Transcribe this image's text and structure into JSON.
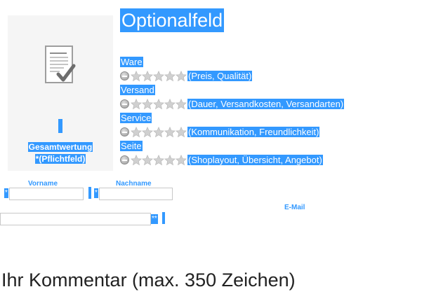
{
  "summary": {
    "icon": "document-check-icon",
    "overall_label": "Gesamtwertung",
    "required_label": "*(Pflichtfeld)"
  },
  "optional": {
    "heading": "Optionalfeld"
  },
  "ratings": [
    {
      "title": "Ware",
      "hint": "(Preis, Qualität)",
      "stars": 0,
      "max_stars": 5
    },
    {
      "title": "Versand",
      "hint": "(Dauer, Versandkosten, Versandarten)",
      "stars": 0,
      "max_stars": 5
    },
    {
      "title": "Service",
      "hint": "(Kommunikation, Freundlichkeit)",
      "stars": 0,
      "max_stars": 5
    },
    {
      "title": "Seite",
      "hint": "(Shoplayout, Übersicht, Angebot)",
      "stars": 0,
      "max_stars": 5
    }
  ],
  "form": {
    "first_name_label": "Vorname",
    "first_name_value": "",
    "first_name_required": "*",
    "last_name_label": "Nachname",
    "last_name_value": "",
    "last_name_required": "*",
    "email_label": "E-Mail",
    "email_value": "",
    "email_required": "**"
  },
  "comment": {
    "heading": "Ihr Kommentar (max. 350 Zeichen)"
  },
  "colors": {
    "highlight": "#3399ff",
    "star_empty": "#d0d0d0",
    "text_dark": "#222222"
  }
}
